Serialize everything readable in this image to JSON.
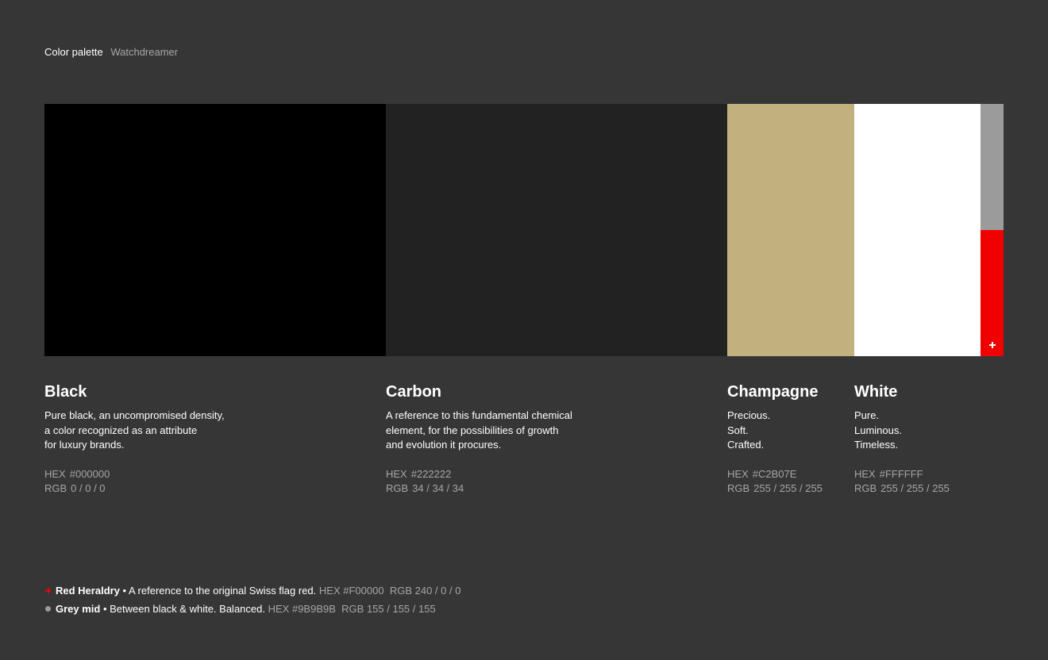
{
  "header": {
    "title": "Color palette",
    "subtitle": "Watchdreamer"
  },
  "colors": [
    {
      "name": "Black",
      "swatch": "#000000",
      "description": [
        "Pure black, an uncompromised density,",
        "a color recognized as an attribute",
        "for luxury brands."
      ],
      "hex_label": "HEX",
      "hex": "#000000",
      "rgb_label": "RGB",
      "rgb": "0 / 0 / 0"
    },
    {
      "name": "Carbon",
      "swatch": "#222222",
      "description": [
        "A reference to this fundamental chemical",
        "element, for the possibilities of growth",
        "and evolution it procures."
      ],
      "hex_label": "HEX",
      "hex": "#222222",
      "rgb_label": "RGB",
      "rgb": "34 / 34 / 34"
    },
    {
      "name": "Champagne",
      "swatch": "#C2B07E",
      "description": [
        "Precious.",
        "Soft.",
        "Crafted."
      ],
      "hex_label": "HEX",
      "hex": "#C2B07E",
      "rgb_label": "RGB",
      "rgb": "255 / 255 / 255"
    },
    {
      "name": "White",
      "swatch": "#FFFFFF",
      "description": [
        "Pure.",
        "Luminous.",
        "Timeless."
      ],
      "hex_label": "HEX",
      "hex": "#FFFFFF",
      "rgb_label": "RGB",
      "rgb": "255 / 255 / 255"
    }
  ],
  "accents": {
    "grey_swatch": "#9B9B9B",
    "red_swatch": "#F00000"
  },
  "footnotes": [
    {
      "name": "Red Heraldry",
      "separator": " • ",
      "text": "A reference to the original Swiss flag red.",
      "hex_label": "HEX",
      "hex": "#F00000",
      "rgb_label": "RGB",
      "rgb": "240 / 0 / 0",
      "marker": "cross-icon",
      "marker_color": "#F00000"
    },
    {
      "name": "Grey mid",
      "separator": " • ",
      "text": "Between black & white. Balanced.",
      "hex_label": "HEX",
      "hex": "#9B9B9B",
      "rgb_label": "RGB",
      "rgb": "155 / 155 / 155",
      "marker": "dot-icon",
      "marker_color": "#9B9B9B"
    }
  ]
}
